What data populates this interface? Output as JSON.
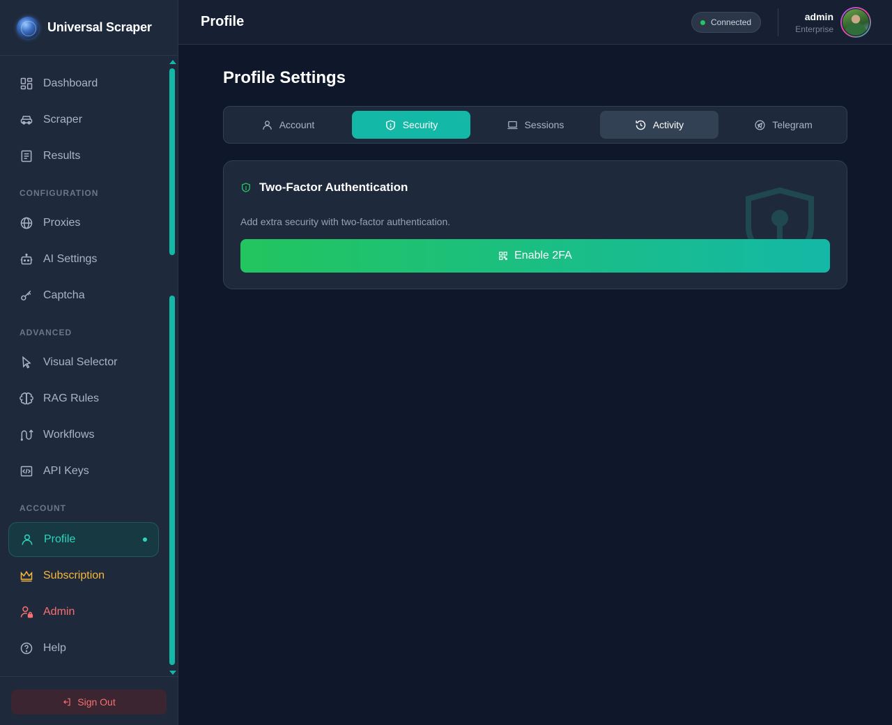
{
  "brand": {
    "name": "Universal Scraper"
  },
  "sidebar": {
    "items": [
      {
        "label": "Dashboard",
        "icon": "dashboard-icon"
      },
      {
        "label": "Scraper",
        "icon": "bot-icon"
      },
      {
        "label": "Results",
        "icon": "results-icon"
      },
      {
        "label": "Proxies",
        "icon": "globe-icon"
      },
      {
        "label": "AI Settings",
        "icon": "robot-icon"
      },
      {
        "label": "Captcha",
        "icon": "key-icon"
      },
      {
        "label": "Visual Selector",
        "icon": "cursor-icon"
      },
      {
        "label": "RAG Rules",
        "icon": "brain-icon"
      },
      {
        "label": "Workflows",
        "icon": "workflow-icon"
      },
      {
        "label": "API Keys",
        "icon": "code-icon"
      },
      {
        "label": "Profile",
        "icon": "user-icon"
      },
      {
        "label": "Subscription",
        "icon": "crown-icon"
      },
      {
        "label": "Admin",
        "icon": "user-lock-icon"
      },
      {
        "label": "Help",
        "icon": "help-icon"
      }
    ],
    "sections": {
      "configuration": "CONFIGURATION",
      "advanced": "ADVANCED",
      "account": "ACCOUNT"
    },
    "sign_out": "Sign Out"
  },
  "header": {
    "title": "Profile",
    "status": "Connected",
    "user_name": "admin",
    "user_plan": "Enterprise"
  },
  "main": {
    "title": "Profile Settings",
    "tabs": [
      {
        "label": "Account"
      },
      {
        "label": "Security"
      },
      {
        "label": "Sessions"
      },
      {
        "label": "Activity"
      },
      {
        "label": "Telegram"
      }
    ],
    "card": {
      "title": "Two-Factor Authentication",
      "description": "Add extra security with two-factor authentication.",
      "button": "Enable 2FA"
    }
  },
  "colors": {
    "accent": "#14b8a6",
    "success": "#22c55e",
    "danger": "#f87171",
    "gold": "#f6b93b",
    "background": "#0f172a",
    "surface": "#1e293b"
  }
}
